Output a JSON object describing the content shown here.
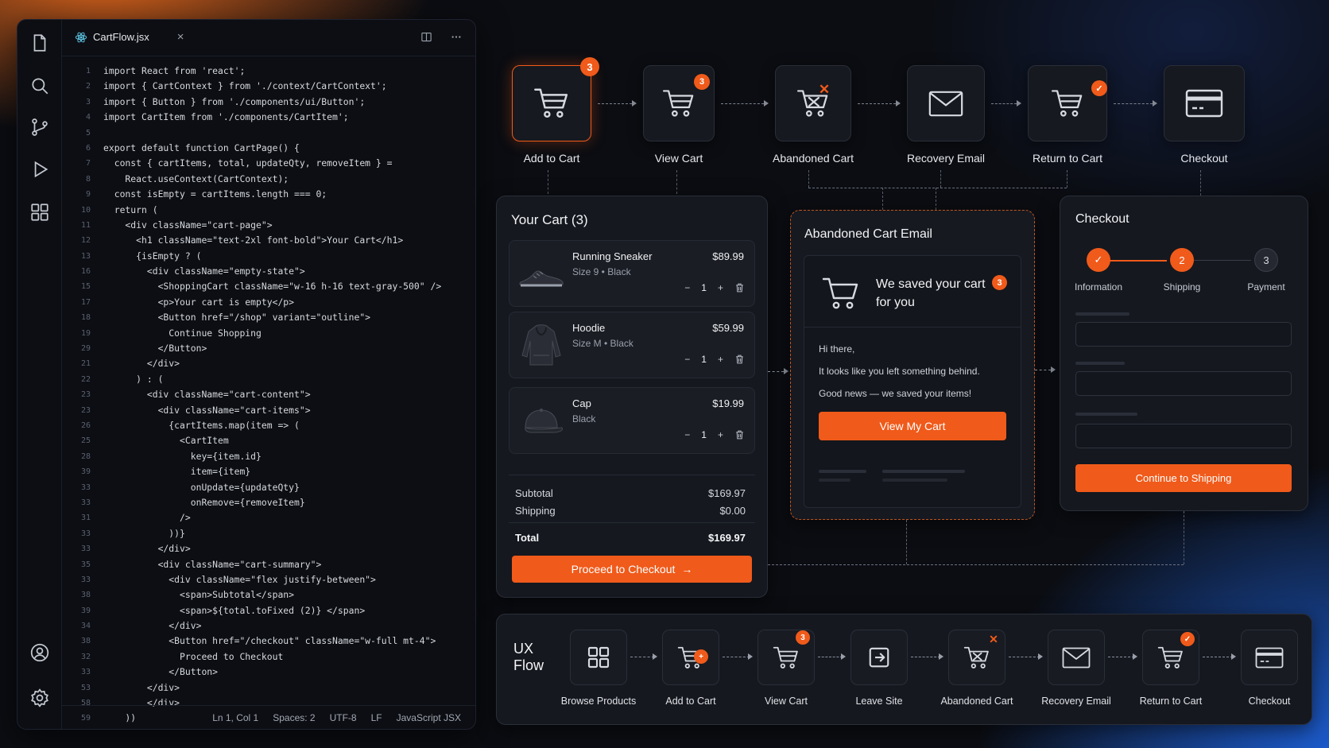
{
  "editor": {
    "tab_name": "CartFlow.jsx",
    "close_glyph": "×",
    "activity_icons": [
      "files-icon",
      "search-icon",
      "source-control-icon",
      "run-icon",
      "extensions-icon"
    ],
    "bottom_icons": [
      "account-icon",
      "settings-icon"
    ],
    "lines": [
      {
        "n": "1",
        "t": "import React from 'react';"
      },
      {
        "n": "2",
        "t": "import { CartContext } from './context/CartContext';"
      },
      {
        "n": "3",
        "t": "import { Button } from './components/ui/Button';"
      },
      {
        "n": "4",
        "t": "import CartItem from './components/CartItem';"
      },
      {
        "n": "5",
        "t": ""
      },
      {
        "n": "6",
        "t": "export default function CartPage() {"
      },
      {
        "n": "7",
        "t": "  const { cartItems, total, updateQty, removeItem } ="
      },
      {
        "n": "8",
        "t": "    React.useContext(CartContext);"
      },
      {
        "n": "9",
        "t": "  const isEmpty = cartItems.length === 0;"
      },
      {
        "n": "10",
        "t": "  return ("
      },
      {
        "n": "11",
        "t": "    <div className=\"cart-page\">"
      },
      {
        "n": "12",
        "t": "      <h1 className=\"text-2xl font-bold\">Your Cart</h1>"
      },
      {
        "n": "13",
        "t": "      {isEmpty ? ("
      },
      {
        "n": "16",
        "t": "        <div className=\"empty-state\">"
      },
      {
        "n": "15",
        "t": "          <ShoppingCart className=\"w-16 h-16 text-gray-500\" />"
      },
      {
        "n": "17",
        "t": "          <p>Your cart is empty</p>"
      },
      {
        "n": "18",
        "t": "          <Button href=\"/shop\" variant=\"outline\">"
      },
      {
        "n": "19",
        "t": "            Continue Shopping"
      },
      {
        "n": "29",
        "t": "          </Button>"
      },
      {
        "n": "21",
        "t": "        </div>"
      },
      {
        "n": "22",
        "t": "      ) : ("
      },
      {
        "n": "23",
        "t": "        <div className=\"cart-content\">"
      },
      {
        "n": "23",
        "t": "          <div className=\"cart-items\">"
      },
      {
        "n": "26",
        "t": "            {cartItems.map(item => ("
      },
      {
        "n": "25",
        "t": "              <CartItem"
      },
      {
        "n": "28",
        "t": "                key={item.id}"
      },
      {
        "n": "39",
        "t": "                item={item}"
      },
      {
        "n": "33",
        "t": "                onUpdate={updateQty}"
      },
      {
        "n": "33",
        "t": "                onRemove={removeItem}"
      },
      {
        "n": "31",
        "t": "              />"
      },
      {
        "n": "33",
        "t": "            ))}"
      },
      {
        "n": "33",
        "t": "          </div>"
      },
      {
        "n": "35",
        "t": "          <div className=\"cart-summary\">"
      },
      {
        "n": "33",
        "t": "            <div className=\"flex justify-between\">"
      },
      {
        "n": "38",
        "t": "              <span>Subtotal</span>"
      },
      {
        "n": "39",
        "t": "              <span>${total.toFixed (2)} </span>"
      },
      {
        "n": "34",
        "t": "            </div>"
      },
      {
        "n": "38",
        "t": "            <Button href=\"/checkout\" className=\"w-full mt-4\">"
      },
      {
        "n": "32",
        "t": "              Proceed to Checkout"
      },
      {
        "n": "33",
        "t": "            </Button>"
      },
      {
        "n": "53",
        "t": "        </div>"
      },
      {
        "n": "58",
        "t": "        </div>"
      },
      {
        "n": "59",
        "t": "    ))"
      },
      {
        "n": "40",
        "t": "  </div>"
      }
    ],
    "status": [
      "Ln 1, Col 1",
      "Spaces: 2",
      "UTF-8",
      "LF",
      "JavaScript JSX"
    ]
  },
  "flow": [
    {
      "label": "Add to Cart",
      "badge": "3"
    },
    {
      "label": "View Cart",
      "badge": "3"
    },
    {
      "label": "Abandoned Cart",
      "badge": "✕"
    },
    {
      "label": "Recovery Email",
      "badge": ""
    },
    {
      "label": "Return to Cart",
      "badge": "✓"
    },
    {
      "label": "Checkout",
      "badge": ""
    }
  ],
  "cart": {
    "title": "Your Cart (3)",
    "items": [
      {
        "name": "Running Sneaker",
        "meta": "Size 9  •  Black",
        "price": "$89.99",
        "qty": "1"
      },
      {
        "name": "Hoodie",
        "meta": "Size M  •  Black",
        "price": "$59.99",
        "qty": "1"
      },
      {
        "name": "Cap",
        "meta": "Black",
        "price": "$19.99",
        "qty": "1"
      }
    ],
    "minus": "−",
    "plus": "+",
    "subtotal_label": "Subtotal",
    "subtotal": "$169.97",
    "shipping_label": "Shipping",
    "shipping": "$0.00",
    "total_label": "Total",
    "total": "$169.97",
    "cta": "Proceed to Checkout",
    "cta_arrow": "→"
  },
  "email": {
    "title": "Abandoned Cart Email",
    "headline": "We saved your cart for you",
    "badge": "3",
    "greeting": "Hi there,",
    "line1": "It looks like you left something behind.",
    "line2": "Good news — we saved your items!",
    "cta": "View My Cart"
  },
  "checkout": {
    "title": "Checkout",
    "steps": [
      {
        "num": "✓",
        "label": "Information"
      },
      {
        "num": "2",
        "label": "Shipping"
      },
      {
        "num": "3",
        "label": "Payment"
      }
    ],
    "cta": "Continue to Shipping"
  },
  "ux": {
    "title_line1": "UX",
    "title_line2": "Flow",
    "steps": [
      {
        "label": "Browse Products",
        "badge": ""
      },
      {
        "label": "Add to Cart",
        "badge": "+"
      },
      {
        "label": "View Cart",
        "badge": "3"
      },
      {
        "label": "Leave Site",
        "badge": ""
      },
      {
        "label": "Abandoned Cart",
        "badge": "✕"
      },
      {
        "label": "Recovery Email",
        "badge": ""
      },
      {
        "label": "Return to Cart",
        "badge": "✓"
      },
      {
        "label": "Checkout",
        "badge": ""
      }
    ]
  },
  "colors": {
    "accent": "#f05a1a",
    "panel": "#15181f",
    "bg": "#0b0d12"
  }
}
